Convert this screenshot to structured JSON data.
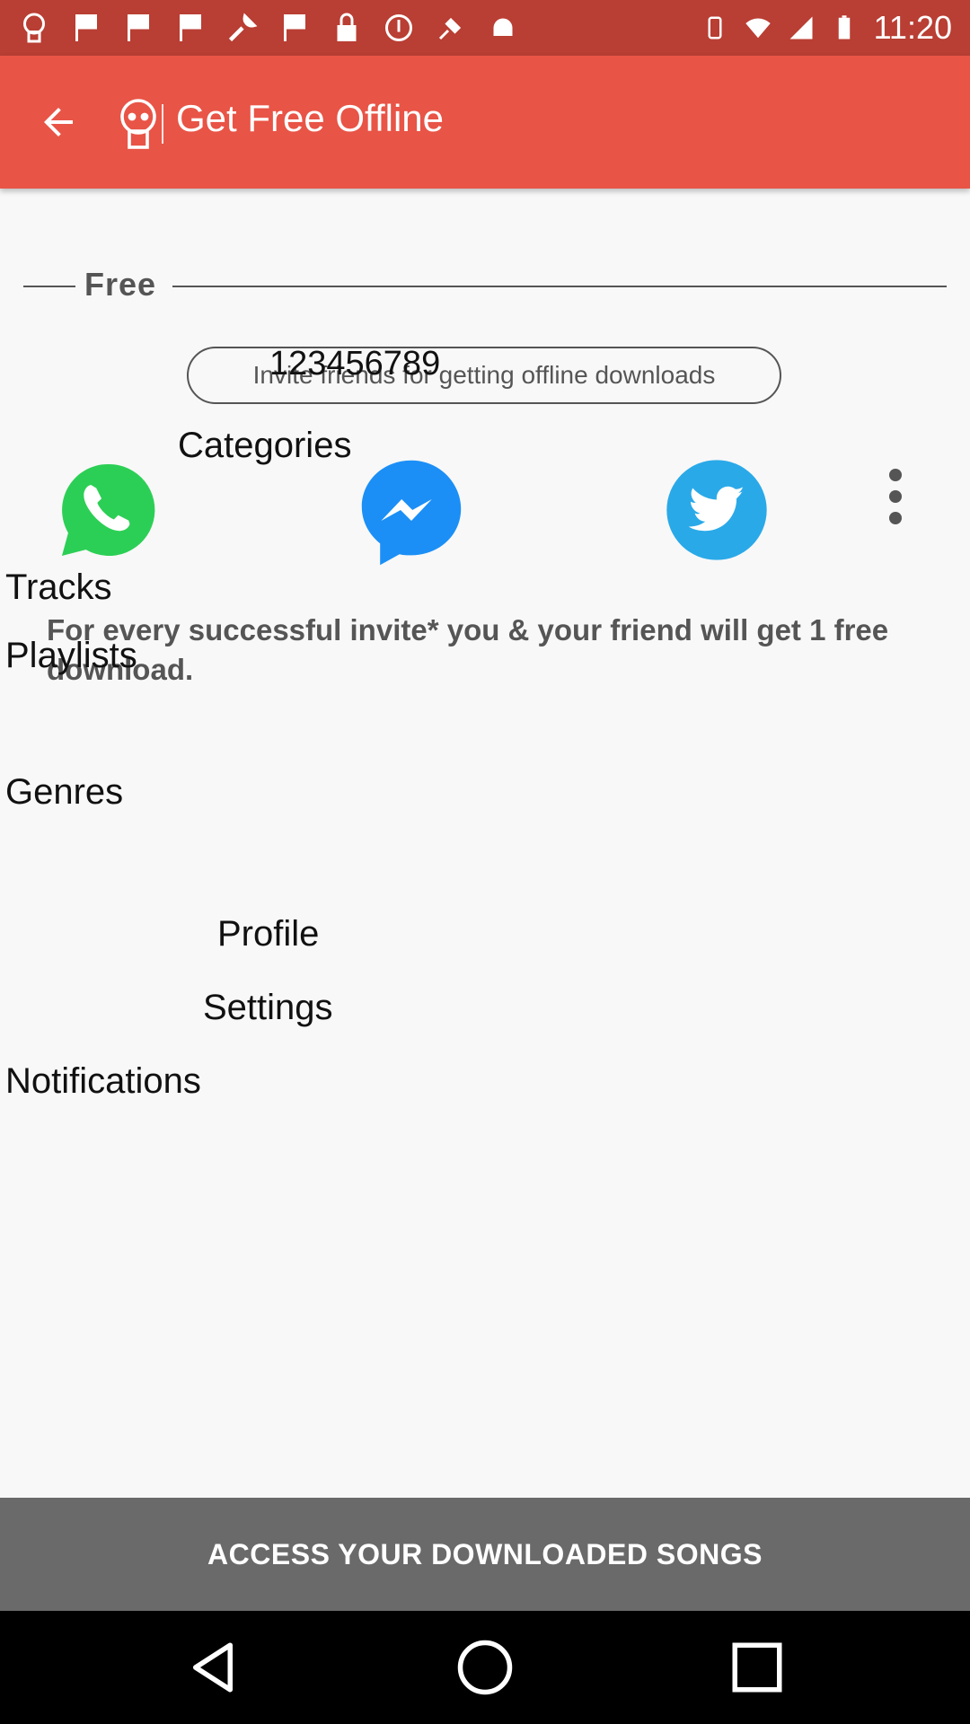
{
  "status_bar": {
    "time": "11:20",
    "left_icons": [
      "app-notification-icon",
      "flag-icon",
      "flag-icon",
      "flag-icon",
      "wrench-icon",
      "flag-icon",
      "lock-icon",
      "info-icon",
      "fake-gps-icon",
      "android-icon"
    ],
    "right_icons": [
      "vibrate-icon",
      "wifi-icon",
      "signal-icon",
      "battery-icon"
    ]
  },
  "app_bar": {
    "title": "Get Free Offline",
    "color": "#e85446"
  },
  "free_section": {
    "label": "Free"
  },
  "invite_pill": {
    "label": "Invite friends for getting offline downloads"
  },
  "overlay": {
    "number": "123456789",
    "categories": "Categories",
    "tracks": "Tracks",
    "playlists": "Playlists",
    "genres": "Genres",
    "profile": "Profile",
    "settings": "Settings",
    "notifications": "Notifications"
  },
  "share": {
    "icons": [
      "whatsapp-icon",
      "messenger-icon",
      "twitter-icon",
      "more-vert-icon"
    ],
    "colors": {
      "whatsapp": "#2ccf55",
      "messenger": "#1b8ff6",
      "twitter": "#2aa9e8"
    }
  },
  "invite_info": {
    "text": "For every successful invite* you & your friend will get 1 free download."
  },
  "bottom_button": {
    "label": "ACCESS YOUR DOWNLOADED SONGS"
  }
}
